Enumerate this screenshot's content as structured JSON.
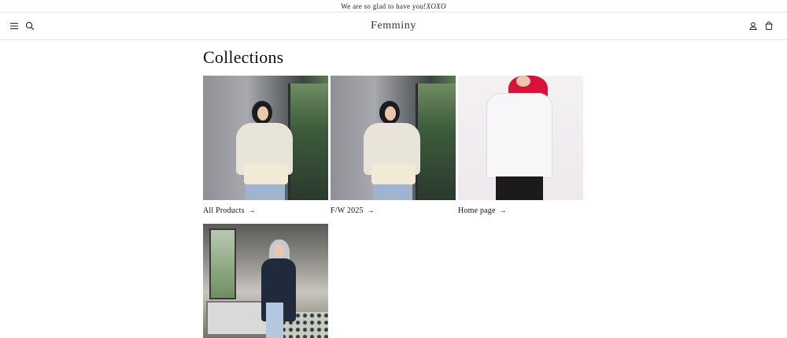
{
  "announcement": {
    "text": "We are so glad to have you!",
    "emphasis": "XOXO"
  },
  "header": {
    "logo": "Femminy",
    "icons": [
      "menu-icon",
      "search-icon",
      "account-icon",
      "cart-icon"
    ]
  },
  "page": {
    "title": "Collections"
  },
  "collections": [
    {
      "label": "All Products",
      "arrow": "→"
    },
    {
      "label": "F/W 2025",
      "arrow": "→"
    },
    {
      "label": "Home page",
      "arrow": "→"
    },
    {
      "label": "",
      "arrow": ""
    }
  ],
  "colors": {
    "text": "#121212",
    "border": "#e6e6e6",
    "background": "#ffffff"
  }
}
